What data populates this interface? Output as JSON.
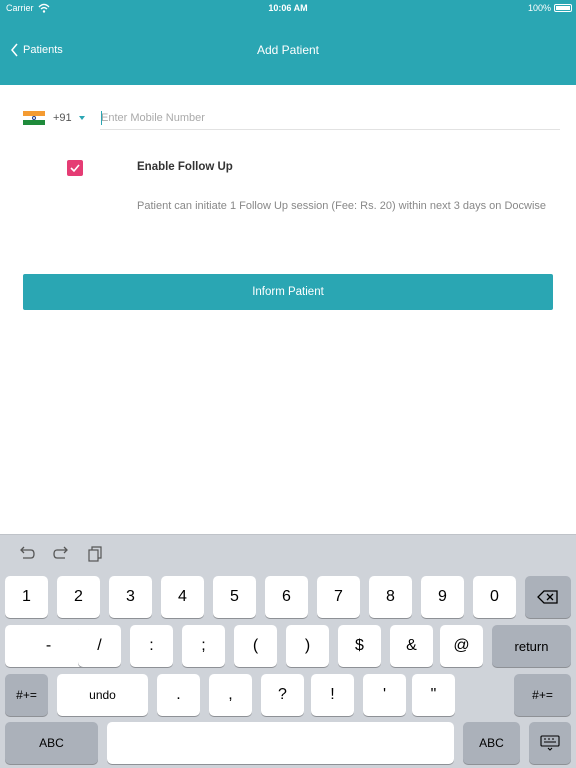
{
  "status_bar": {
    "carrier": "Carrier",
    "time": "10:06 AM",
    "battery": "100%"
  },
  "nav": {
    "back_label": "Patients",
    "title": "Add Patient"
  },
  "phone": {
    "country_code": "+91",
    "placeholder": "Enter Mobile Number",
    "value": ""
  },
  "follow_up": {
    "checked": true,
    "title": "Enable Follow Up",
    "description": "Patient can initiate 1 Follow Up session (Fee: Rs. 20) within next 3 days on Docwise"
  },
  "inform_button": "Inform Patient",
  "colors": {
    "accent": "#2aa6b3",
    "checkbox": "#e53c74",
    "keyboard_bg": "#cfd3d9"
  },
  "keyboard": {
    "toolbar_icons": [
      "undo-icon",
      "redo-icon",
      "paste-icon"
    ],
    "row1": [
      "1",
      "2",
      "3",
      "4",
      "5",
      "6",
      "7",
      "8",
      "9",
      "0"
    ],
    "row2": [
      "-",
      "/",
      ":",
      ";",
      "(",
      ")",
      "$",
      "&",
      "@"
    ],
    "return_label": "return",
    "symbols_label": "#+=",
    "undo_label": "undo",
    "row3": [
      ".",
      ",",
      "?",
      "!",
      "'",
      "\""
    ],
    "abc_label": "ABC"
  }
}
